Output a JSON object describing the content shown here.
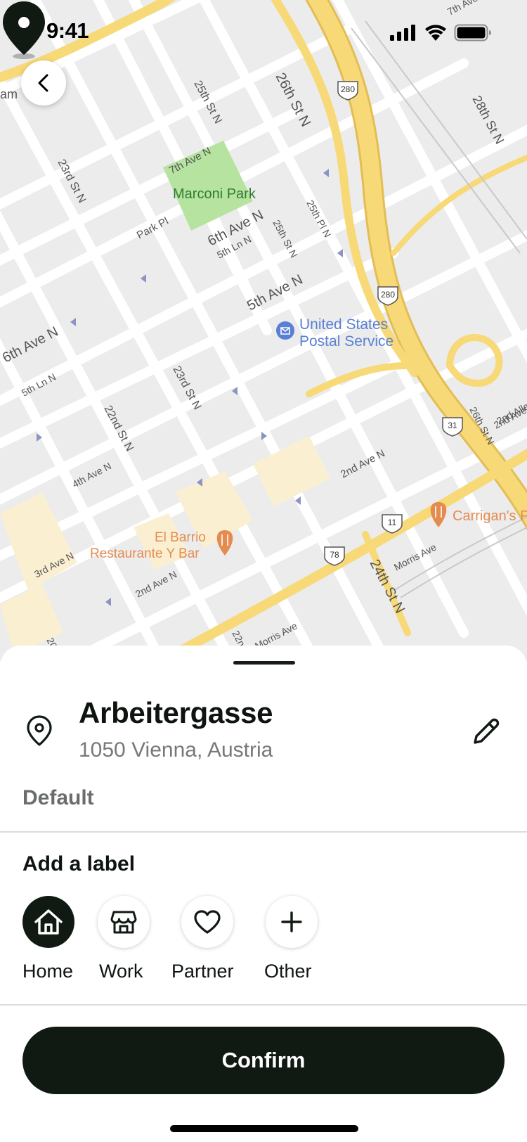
{
  "status_bar": {
    "time": "9:41"
  },
  "map": {
    "park_label": "Marconi Park",
    "poi": [
      {
        "label": "United States Postal Service",
        "line1": "United States",
        "line2": "Postal Service"
      },
      {
        "label": "El Barrio Restaurante Y Bar",
        "line1": "El Barrio",
        "line2": "Restaurante Y Bar"
      },
      {
        "label": "Carrigan's",
        "line1": "Carrigan's P"
      }
    ],
    "partial_label": "am",
    "streets": [
      "26th St N",
      "25th St N",
      "7th Ave N",
      "28th St N",
      "23rd St N",
      "Park Pl",
      "6th Ave N",
      "5th Ln N",
      "25th St N",
      "25th Pl N",
      "5th Ave N",
      "6th Ave N",
      "5th Ln N",
      "23rd St N",
      "22nd St N",
      "4th Ave N",
      "2nd Ave N",
      "26th St N",
      "2nd Ave N",
      "3rd Ave N",
      "2nd Ave N",
      "Morris Ave",
      "24th St N",
      "Morris Ave",
      "7th Ave",
      "2nd Alle",
      "22n",
      "20"
    ],
    "shields": [
      "280",
      "280",
      "31",
      "11",
      "78"
    ],
    "colors": {
      "land": "#ececec",
      "park": "#b7e3a0",
      "highway": "#f7d978",
      "poi_blue": "#5a7fd6",
      "poi_orange": "#e58b4f"
    }
  },
  "back_button": {
    "icon": "chevron-left-icon"
  },
  "sheet": {
    "title": "Arbeitergasse",
    "subtitle": "1050 Vienna, Austria",
    "default_text": "Default",
    "add_label_heading": "Add a label",
    "labels": [
      {
        "name": "Home",
        "icon": "home-icon",
        "selected": true
      },
      {
        "name": "Work",
        "icon": "store-icon",
        "selected": false
      },
      {
        "name": "Partner",
        "icon": "heart-icon",
        "selected": false
      },
      {
        "name": "Other",
        "icon": "plus-icon",
        "selected": false
      }
    ],
    "confirm_label": "Confirm"
  }
}
